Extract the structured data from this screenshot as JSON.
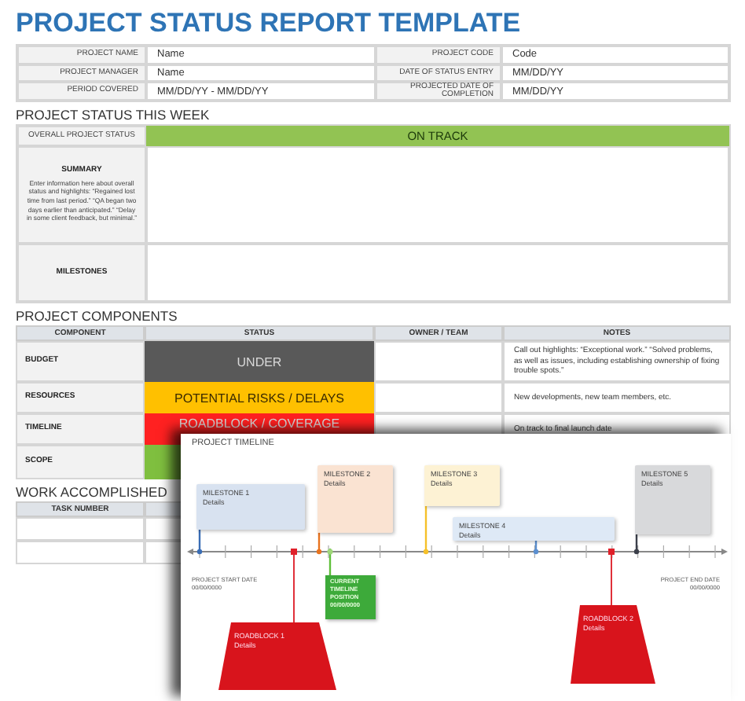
{
  "title": "PROJECT STATUS REPORT TEMPLATE",
  "project_info": [
    {
      "label": "PROJECT NAME",
      "value": "Name",
      "label_2": "PROJECT CODE",
      "value_2": "Code"
    },
    {
      "label": "PROJECT MANAGER",
      "value": "Name",
      "label_2": "DATE OF STATUS ENTRY",
      "value_2": "MM/DD/YY"
    },
    {
      "label": "PERIOD COVERED",
      "value": "MM/DD/YY - MM/DD/YY",
      "label_2": "PROJECTED DATE OF COMPLETION",
      "value_2": "MM/DD/YY"
    }
  ],
  "status_this_week": {
    "heading": "PROJECT STATUS THIS WEEK",
    "overall_label": "OVERALL PROJECT STATUS",
    "overall_status": "ON TRACK",
    "summary_label": "SUMMARY",
    "summary_hint": "Enter information here about overall status and highlights: “Regained lost time from last period.” “QA began two days earlier than anticipated.” “Delay in some client feedback, but minimal.”",
    "milestones_label": "MILESTONES"
  },
  "components": {
    "heading": "PROJECT COMPONENTS",
    "columns": [
      "COMPONENT",
      "STATUS",
      "OWNER / TEAM",
      "NOTES"
    ],
    "rows": [
      {
        "component": "BUDGET",
        "status": "UNDER",
        "color": "#595959",
        "notes": "Call out highlights: “Exceptional work.” “Solved problems, as well as issues, including establishing ownership of fixing trouble spots.”"
      },
      {
        "component": "RESOURCES",
        "status": "POTENTIAL RISKS / DELAYS",
        "color": "#ffc000",
        "notes": "New developments, new team members, etc."
      },
      {
        "component": "TIMELINE",
        "status": "ROADBLOCK / COVERAGE",
        "color": "#ff2121",
        "notes": "On track to final launch date"
      },
      {
        "component": "SCOPE",
        "color": "#7fbf3f"
      }
    ]
  },
  "work_accomplished": {
    "heading": "WORK ACCOMPLISHED",
    "columns": [
      "TASK NUMBER"
    ]
  },
  "timeline": {
    "title": "PROJECT TIMELINE",
    "milestones": [
      {
        "title": "MILESTONE 1",
        "details": "Details",
        "color": "#3a6db5"
      },
      {
        "title": "MILESTONE 2",
        "details": "Details",
        "color": "#e8731e"
      },
      {
        "title": "MILESTONE 3",
        "details": "Details",
        "color": "#f5c02a"
      },
      {
        "title": "MILESTONE 4",
        "details": "Details",
        "color": "#5b8fd0"
      },
      {
        "title": "MILESTONE 5",
        "details": "Details",
        "color": "#3b3f4a"
      }
    ],
    "roadblocks": [
      {
        "title": "ROADBLOCK 1",
        "details": "Details"
      },
      {
        "title": "ROADBLOCK 2",
        "details": "Details"
      }
    ],
    "current_position": {
      "label": "CURRENT TIMELINE POSITION",
      "date": "00/00/0000"
    },
    "start": {
      "label": "PROJECT START DATE",
      "date": "00/00/0000"
    },
    "end": {
      "label": "PROJECT END DATE",
      "date": "00/00/0000"
    }
  }
}
